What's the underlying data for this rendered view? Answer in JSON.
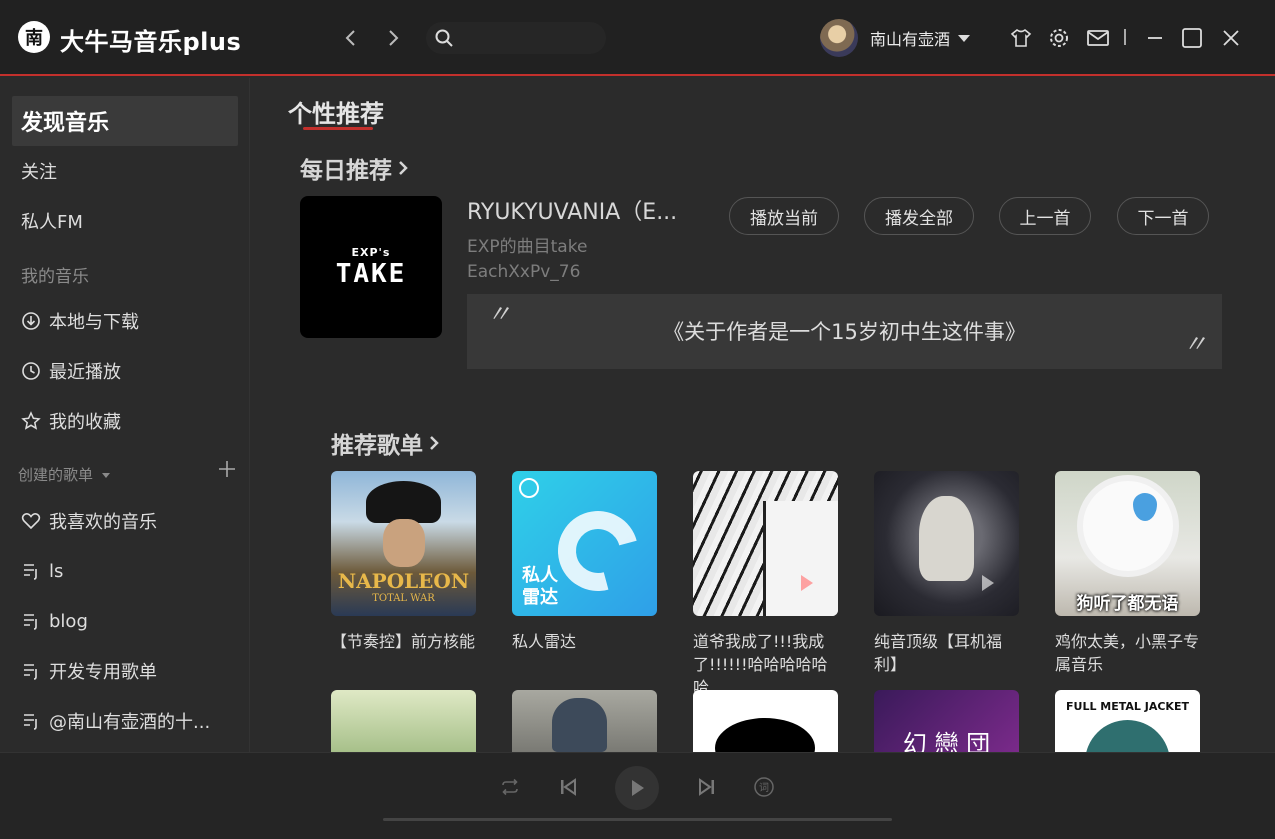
{
  "app": {
    "logo_char": "南",
    "title": "大牛马音乐plus"
  },
  "user": {
    "name": "南山有壶酒"
  },
  "sidebar": {
    "discover": "发现音乐",
    "follow": "关注",
    "fm": "私人FM",
    "my_music_header": "我的音乐",
    "my_music": [
      {
        "label": "本地与下载",
        "icon": "download-icon"
      },
      {
        "label": "最近播放",
        "icon": "clock-icon"
      },
      {
        "label": "我的收藏",
        "icon": "star-icon"
      }
    ],
    "created_header": "创建的歌单",
    "playlists": [
      {
        "label": "我喜欢的音乐",
        "icon": "heart-icon"
      },
      {
        "label": "ls",
        "icon": "playlist-icon"
      },
      {
        "label": "blog",
        "icon": "playlist-icon"
      },
      {
        "label": "开发专用歌单",
        "icon": "playlist-icon"
      },
      {
        "label": "@南山有壶酒的十...",
        "icon": "playlist-icon"
      }
    ]
  },
  "main": {
    "tab": "个性推荐",
    "daily_title": "每日推荐",
    "song": {
      "cover_small": "EXP's",
      "cover_big": "TAKE",
      "title": "RYUKYUVANIA（E...",
      "album": "EXP的曲目take",
      "artist": "EachXxPv_76"
    },
    "buttons": {
      "play_current": "播放当前",
      "play_all": "播发全部",
      "prev": "上一首",
      "next": "下一首"
    },
    "quote": {
      "open": "〃",
      "text": "《关于作者是一个15岁初中生这件事》",
      "close": "〃"
    },
    "playlists_title": "推荐歌单",
    "playlist_cards": [
      {
        "name": "【节奏控】前方核能",
        "cover_text": "NAPOLEON",
        "cover_sub": "TOTAL WAR"
      },
      {
        "name": "私人雷达",
        "cover_text": "私人\n雷达"
      },
      {
        "name": "道爷我成了!!!我成了!!!!!!哈哈哈哈哈哈",
        "cover_text": ""
      },
      {
        "name": "纯音顶级【耳机福利】",
        "cover_text": ""
      },
      {
        "name": "鸡你太美，小黑子专属音乐",
        "cover_text": "狗听了都无语"
      }
    ],
    "row2_texts": [
      "",
      "",
      "",
      "幻 戀 団",
      "FULL METAL JACKET"
    ]
  },
  "colors": {
    "accent": "#c3302c",
    "bg": "#2b2b2b",
    "titlebar": "#212121",
    "radar": "#33b6e8"
  }
}
